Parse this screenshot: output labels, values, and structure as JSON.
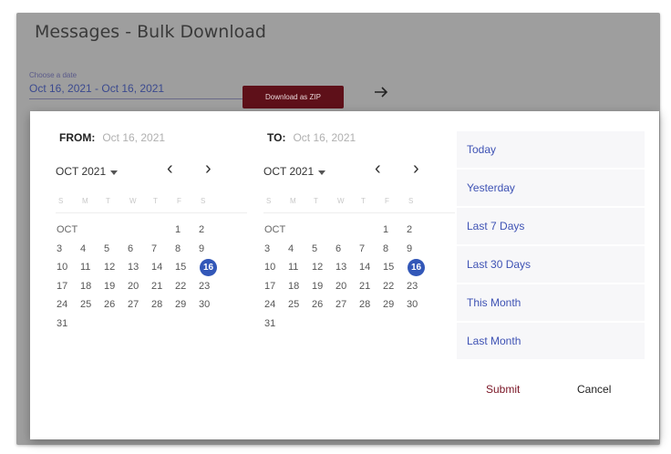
{
  "page": {
    "title": "Messages - Bulk Download"
  },
  "date_field": {
    "label": "Choose a date",
    "value": "Oct 16, 2021 - Oct 16, 2021"
  },
  "toolbar": {
    "zip_label": "Download as ZIP",
    "arrow_icon": "arrow-right-icon"
  },
  "picker": {
    "from": {
      "label": "FROM:",
      "value": "Oct 16, 2021"
    },
    "to": {
      "label": "TO:",
      "value": "Oct 16, 2021"
    },
    "calendars": [
      {
        "month_select": "OCT 2021",
        "month_tag": "OCT",
        "weekdays": [
          "S",
          "M",
          "T",
          "W",
          "T",
          "F",
          "S"
        ],
        "rows": [
          [
            "1",
            "2"
          ],
          [
            "3",
            "4",
            "5",
            "6",
            "7",
            "8",
            "9"
          ],
          [
            "10",
            "11",
            "12",
            "13",
            "14",
            "15",
            "16"
          ],
          [
            "17",
            "18",
            "19",
            "20",
            "21",
            "22",
            "23"
          ],
          [
            "24",
            "25",
            "26",
            "27",
            "28",
            "29",
            "30"
          ],
          [
            "31"
          ]
        ],
        "selected": "16"
      },
      {
        "month_select": "OCT 2021",
        "month_tag": "OCT",
        "weekdays": [
          "S",
          "M",
          "T",
          "W",
          "T",
          "F",
          "S"
        ],
        "rows": [
          [
            "1",
            "2"
          ],
          [
            "3",
            "4",
            "5",
            "6",
            "7",
            "8",
            "9"
          ],
          [
            "10",
            "11",
            "12",
            "13",
            "14",
            "15",
            "16"
          ],
          [
            "17",
            "18",
            "19",
            "20",
            "21",
            "22",
            "23"
          ],
          [
            "24",
            "25",
            "26",
            "27",
            "28",
            "29",
            "30"
          ],
          [
            "31"
          ]
        ],
        "selected": "16"
      }
    ],
    "quick_ranges": [
      "Today",
      "Yesterday",
      "Last 7 Days",
      "Last 30 Days",
      "This Month",
      "Last Month"
    ],
    "submit_label": "Submit",
    "cancel_label": "Cancel"
  },
  "colors": {
    "accent": "#5e1019",
    "selected_day": "#3257b8",
    "link": "#3e52b4"
  }
}
